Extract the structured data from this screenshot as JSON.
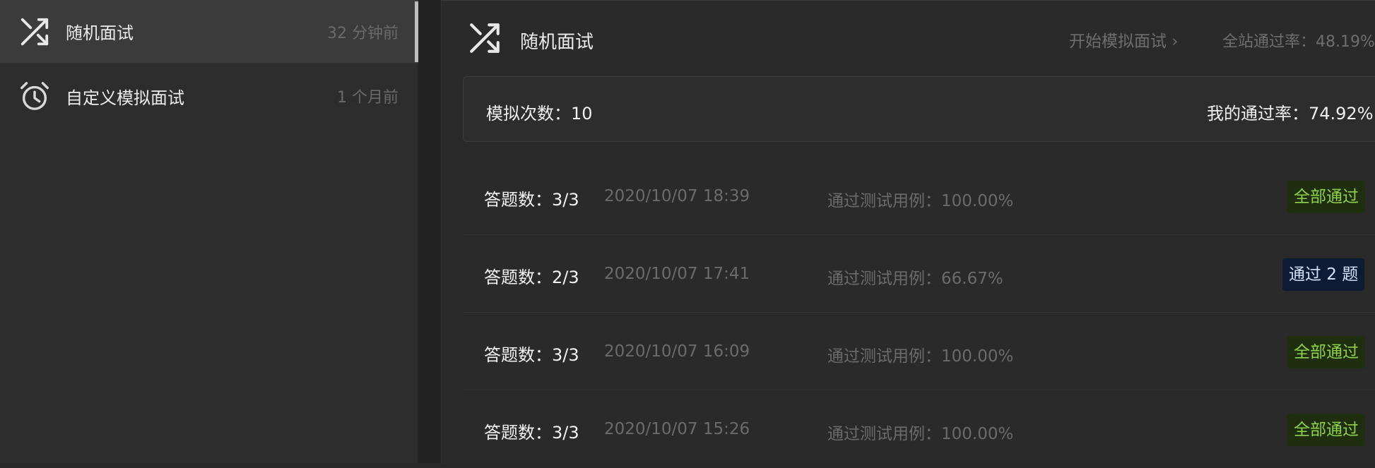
{
  "sidebar": {
    "items": [
      {
        "icon": "shuffle-icon",
        "label": "随机面试",
        "time": "32 分钟前",
        "active": true
      },
      {
        "icon": "alarm-clock-icon",
        "label": "自定义模拟面试",
        "time": "1 个月前",
        "active": false
      }
    ]
  },
  "header": {
    "icon": "shuffle-icon",
    "title": "随机面试",
    "start_label": "开始模拟面试 ›",
    "site_pass_rate": "全站通过率：48.19%"
  },
  "stats": {
    "count_label": "模拟次数：10",
    "my_rate_label": "我的通过率：74.92%"
  },
  "records": [
    {
      "answers": "答题数：3/3",
      "datetime": "2020/10/07 18:39",
      "cases": "通过测试用例：100.00%",
      "badge": "全部通过",
      "badge_color": "#8fd14f"
    },
    {
      "answers": "答题数：2/3",
      "datetime": "2020/10/07 17:41",
      "cases": "通过测试用例：66.67%",
      "badge": "通过 2 题",
      "badge_color": "#d0e3ff"
    },
    {
      "answers": "答题数：3/3",
      "datetime": "2020/10/07 16:09",
      "cases": "通过测试用例：100.00%",
      "badge": "全部通过",
      "badge_color": "#8fd14f"
    },
    {
      "answers": "答题数：3/3",
      "datetime": "2020/10/07 15:26",
      "cases": "通过测试用例：100.00%",
      "badge": "全部通过",
      "badge_color": "#8fd14f"
    }
  ]
}
